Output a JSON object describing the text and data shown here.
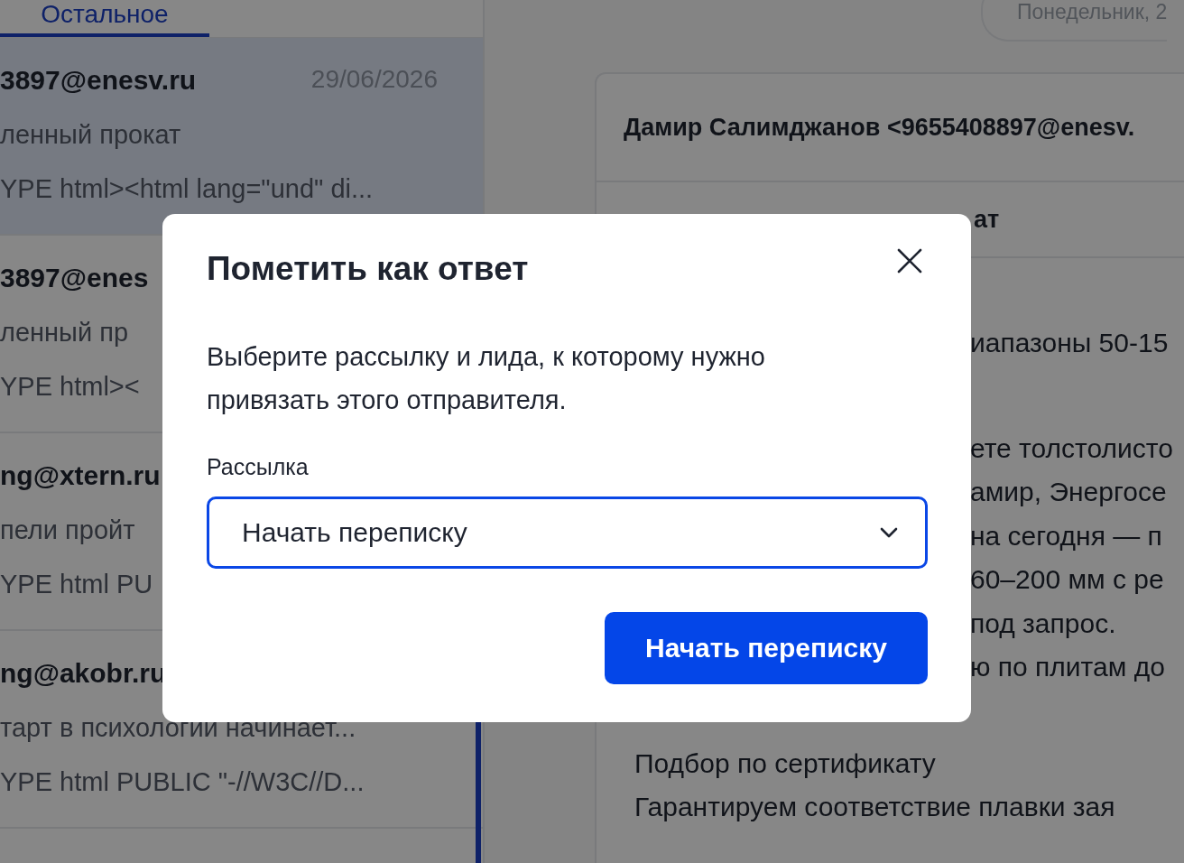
{
  "tabs": [
    {
      "label": "Остальное",
      "selected": true
    }
  ],
  "messages": [
    {
      "sender": "3897@enesv.ru",
      "date": "29/06/2026",
      "subject": "ленный прокат",
      "snippet": "YPE html><html lang=\"und\" di...",
      "selected": true
    },
    {
      "sender": "3897@enes",
      "subject": "ленный пр",
      "snippet": "YPE html><",
      "selected": false
    },
    {
      "sender": "ng@xtern.ru",
      "subject": "пели пройт",
      "snippet": "YPE html PU",
      "selected": false
    },
    {
      "sender": "ng@akobr.ru",
      "subject": "тарт в психологии начинает...",
      "snippet": "YPE html PUBLIC \"-//W3C//D...",
      "selected": false
    }
  ],
  "date_pill": "Понедельник, 2",
  "letter": {
    "from": "Дамир Салимджанов <9655408897@enesv.",
    "subject_tail": "ат",
    "paragraphs": [
      {
        "kind": "clipped",
        "lines": [
          "иапазоны 50-15"
        ]
      },
      {
        "kind": "clipped",
        "lines": [
          "ете толстолисто",
          "амир, Энергосе",
          "на сегодня — п",
          "60–200 мм с ре",
          "под запрос.",
          "ю по плитам до"
        ]
      },
      {
        "kind": "list",
        "lines": [
          "Подбор по сертификату",
          "Гарантируем соответствие плавки зая"
        ]
      }
    ]
  },
  "dialog": {
    "title": "Пометить как ответ",
    "text": "Выберите рассылку и лида, к которому нужно привязать этого отправителя.",
    "field_label": "Рассылка",
    "select": {
      "value": "Начать переписку",
      "focused": true
    },
    "button": "Начать переписку"
  }
}
